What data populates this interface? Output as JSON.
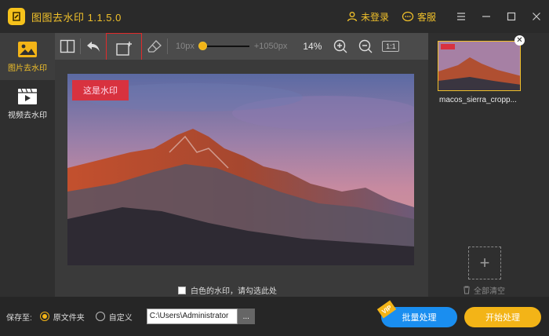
{
  "app": {
    "title": "图图去水印 1.1.5.0",
    "login": "未登录",
    "service": "客服"
  },
  "sidebar": {
    "items": [
      {
        "label": "图片去水印",
        "active": true
      },
      {
        "label": "视频去水印",
        "active": false
      }
    ]
  },
  "toolbar": {
    "brush_min": "10px",
    "brush_max": "+1050px",
    "zoom": "14%",
    "actual_size": "1:1"
  },
  "canvas": {
    "watermark_text": "这是水印",
    "white_wm_option": "白色的水印，请勾选此处"
  },
  "right_panel": {
    "file_name": "macos_sierra_cropp...",
    "clear_all": "全部清空"
  },
  "bottom": {
    "save_to": "保存至:",
    "opt_original": "原文件夹",
    "opt_custom": "自定义",
    "path": "C:\\Users\\Administrator",
    "browse": "...",
    "batch_btn": "批量处理",
    "vip": "VIP",
    "start_btn": "开始处理"
  },
  "colors": {
    "accent": "#f0c02a",
    "batch": "#1a8ef0",
    "watermark": "#d8323f"
  }
}
